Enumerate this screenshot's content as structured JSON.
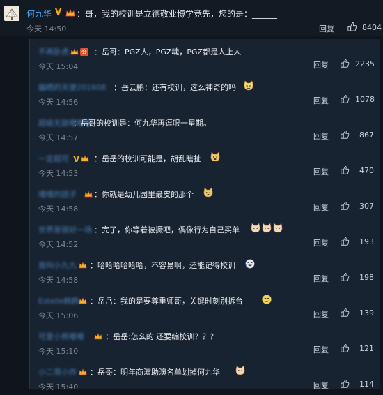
{
  "top_comment": {
    "user": "何九华",
    "text": "：哥，我的校训是立德敬业博学竞先，您的是：______",
    "time": "今天 14:50",
    "reply": "回复",
    "likes": "8404"
  },
  "replies": [
    {
      "user": "不再卧虎…",
      "text": "：岳哥：PGZ人，PGZ魂，PGZ都是人上人",
      "time": "今天 15:04",
      "reply": "回复",
      "likes": "2235",
      "has_vip": true
    },
    {
      "user": "蹦晒的天使201608",
      "text": "：岳云鹏：还有校训，这么神奇的吗",
      "time": "今天 14:56",
      "reply": "回复",
      "likes": "1078",
      "emojis": [
        "smirk-cat"
      ]
    },
    {
      "user": "超级无敌嘟嘟嘟",
      "text": "：岳哥的校训是：何九华再逗哏一星期。",
      "time": "今天 14:57",
      "reply": "回复",
      "likes": "867"
    },
    {
      "user": "一定超可",
      "text": "：岳岳的校训可能是，胡乱瞎扯",
      "time": "今天 14:53",
      "reply": "回复",
      "likes": "470",
      "has_v": true,
      "emojis": [
        "doge"
      ]
    },
    {
      "user": "嘻嘻的团子",
      "text": "：你就是幼儿园里最皮的那个",
      "time": "今天 14:58",
      "reply": "回复",
      "likes": "307",
      "emojis": [
        "doge"
      ]
    },
    {
      "user": "世界是很好一场",
      "text": "：完了，你等着被撅吧，偶像行为自己买单",
      "time": "今天 14:52",
      "reply": "回复",
      "likes": "193",
      "emojis": [
        "cat",
        "cat",
        "cat"
      ]
    },
    {
      "user": "我叫小九九",
      "text": "：哈哈哈哈哈哈，不容易啊，还能记得校训",
      "time": "今天 14:58",
      "reply": "回复",
      "likes": "198",
      "emojis": [
        "laugh-cry"
      ]
    },
    {
      "user": "Estelle韩韩",
      "text": "：岳岳：我的是要尊重师哥，关键时刻别拆台",
      "time": "今天 15:06",
      "reply": "回复",
      "likes": "139",
      "emojis": [
        "smile"
      ]
    },
    {
      "user": "可爱小熊嘟嘟",
      "text": "：岳岳:怎么的 还要编校训？？？",
      "time": "今天 15:10",
      "reply": "回复",
      "likes": "121"
    },
    {
      "user": "小二哥小炸",
      "text": "：岳哥：明年商演助演名单划掉何九华",
      "time": "今天 15:40",
      "reply": "回复",
      "likes": "114",
      "emojis": [
        "cat"
      ]
    }
  ],
  "icons": {
    "like": "thumbs-up-icon",
    "crown": "crown-badge-icon",
    "avatar": "fan-avatar"
  },
  "colors": {
    "username": "#4ea3ff",
    "background": "#10151d",
    "panel": "#172331"
  }
}
